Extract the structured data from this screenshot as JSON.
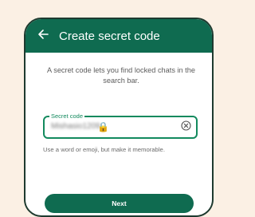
{
  "header": {
    "title": "Create secret code",
    "back_icon": "arrow-back-icon"
  },
  "description": "A secret code lets you find locked chats in the search bar.",
  "secret_code_field": {
    "label": "Secret code",
    "value": "Mishasio1209",
    "emoji": "🔒",
    "clear_icon": "clear-circle-icon"
  },
  "helper_text": "Use a word or emoji, but make it memorable.",
  "next_button": {
    "label": "Next"
  },
  "colors": {
    "brand": "#0f6b50",
    "focus": "#138a5e",
    "background": "#fbf0e4"
  }
}
